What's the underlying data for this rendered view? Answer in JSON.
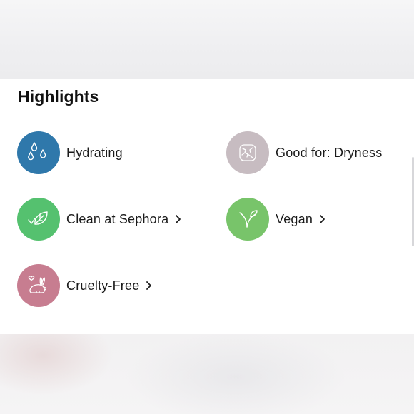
{
  "section": {
    "title": "Highlights",
    "items": [
      {
        "label": "Hydrating",
        "icon": "water-drops-icon",
        "color": "#2f78ab",
        "link": false
      },
      {
        "label": "Good for: Dryness",
        "icon": "dry-skin-icon",
        "color": "#c7bcc1",
        "link": false
      },
      {
        "label": "Clean at Sephora",
        "icon": "leaf-check-icon",
        "color": "#55c16f",
        "link": true
      },
      {
        "label": "Vegan",
        "icon": "sprout-icon",
        "color": "#78c46a",
        "link": true
      },
      {
        "label": "Cruelty-Free",
        "icon": "bunny-heart-icon",
        "color": "#c77d90",
        "link": true
      }
    ]
  }
}
